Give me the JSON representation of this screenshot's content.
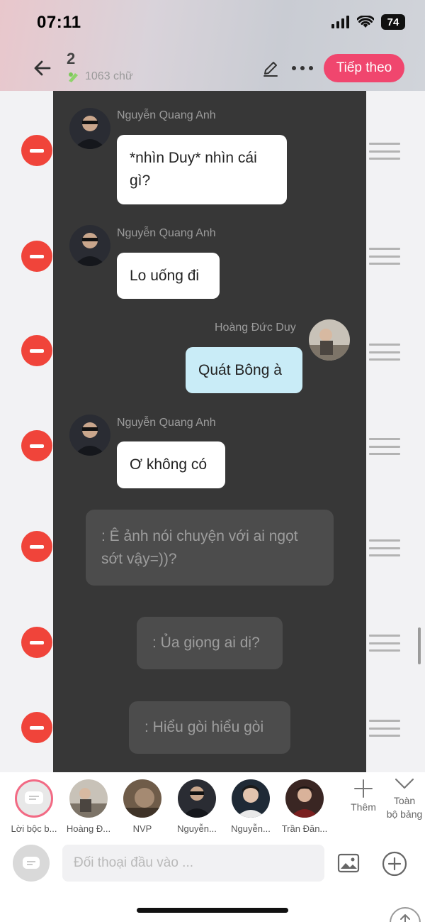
{
  "status": {
    "time": "07:11",
    "battery": "74"
  },
  "header": {
    "chapter": "2",
    "word_count": "1063 chữ",
    "next_button": "Tiếp theo"
  },
  "messages": [
    {
      "sender": "Nguyễn Quang Anh",
      "text": "*nhìn Duy* nhìn cái gì?"
    },
    {
      "sender": "Nguyễn Quang Anh",
      "text": "Lo uống đi"
    },
    {
      "sender": "Hoàng Đức Duy",
      "text": "Quát Bông à"
    },
    {
      "sender": "Nguyễn Quang Anh",
      "text": "Ơ không có"
    },
    {
      "text": ": Ê ảnh nói chuyện với ai ngọt sớt vậy=))?"
    },
    {
      "text": ": Ủa giọng ai dị?"
    },
    {
      "text": ": Hiểu gòi hiểu gòi"
    }
  ],
  "characters": [
    {
      "name": "Lời bộc b..."
    },
    {
      "name": "Hoàng Đ..."
    },
    {
      "name": "NVP"
    },
    {
      "name": "Nguyễn..."
    },
    {
      "name": "Nguyễn..."
    },
    {
      "name": "Trần Đăn..."
    }
  ],
  "char_actions": {
    "add": "Thêm",
    "all_line1": "Toàn",
    "all_line2": "bộ bảng"
  },
  "input": {
    "placeholder": "Đối thoại đầu vào ..."
  },
  "colors": {
    "accent": "#f0466e",
    "remove": "#f0443a",
    "chat_bg": "#373737",
    "self_bubble": "#c9ecf7"
  }
}
